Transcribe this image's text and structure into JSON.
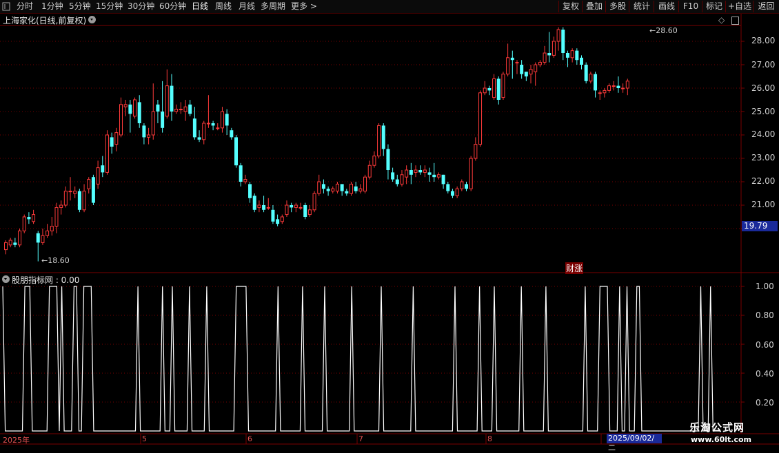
{
  "toolbar": {
    "tabs": [
      "分时",
      "1分钟",
      "5分钟",
      "15分钟",
      "30分钟",
      "60分钟",
      "日线",
      "周线",
      "月线",
      "多周期",
      "更多 >"
    ],
    "active_tab": "日线",
    "right_buttons": [
      "复权",
      "叠加",
      "多股",
      "统计",
      "画线",
      "F10",
      "+自选",
      "返回"
    ]
  },
  "main_title": "上海家化(日线,前复权)",
  "sub_title": "股朋指标网 : 0.00",
  "price_axis": [
    "28.00",
    "27.00",
    "26.00",
    "25.00",
    "24.00",
    "23.00",
    "22.00",
    "21.00"
  ],
  "indicator_axis": [
    "1.00",
    "0.80",
    "0.60",
    "0.40",
    "0.20"
  ],
  "date_labels": [
    "2025年",
    "5",
    "6",
    "7",
    "8"
  ],
  "current_price": "19.79",
  "high_marker": "28.60",
  "low_marker": "18.60",
  "event_label": "财涨",
  "crosshair_date": "2025/09/02/二",
  "watermark_title": "乐淘公式网",
  "watermark_url": "www.60lt.com",
  "colors": {
    "up": "#ff3a3a",
    "down": "#54ffff",
    "grid": "#7a0000",
    "line": "#ffffff",
    "highlight": "#1a2a9a"
  },
  "chart_data": [
    {
      "type": "candlestick",
      "title": "上海家化(日线,前复权)",
      "ylim": [
        19.0,
        28.9
      ],
      "up_color": "#ff3a3a",
      "down_color": "#54ffff",
      "candles": [
        [
          19.1,
          19.4,
          18.9,
          19.5
        ],
        [
          19.3,
          19.5,
          19.2,
          19.6
        ],
        [
          19.4,
          19.3,
          19.2,
          19.6
        ],
        [
          19.3,
          19.9,
          19.2,
          20.0
        ],
        [
          19.9,
          20.5,
          19.8,
          20.6
        ],
        [
          20.5,
          20.4,
          20.2,
          20.7
        ],
        [
          20.3,
          20.6,
          20.2,
          20.8
        ],
        [
          19.8,
          19.4,
          18.6,
          19.9
        ],
        [
          19.4,
          19.7,
          19.3,
          20.0
        ],
        [
          19.7,
          19.9,
          19.6,
          20.2
        ],
        [
          19.9,
          20.1,
          19.7,
          20.5
        ],
        [
          20.1,
          20.9,
          19.8,
          21.1
        ],
        [
          20.9,
          21.0,
          20.6,
          21.2
        ],
        [
          21.0,
          21.6,
          20.9,
          21.8
        ],
        [
          21.6,
          21.6,
          21.2,
          22.2
        ],
        [
          21.5,
          21.6,
          21.3,
          21.8
        ],
        [
          21.6,
          20.8,
          20.7,
          21.7
        ],
        [
          20.8,
          21.6,
          20.7,
          21.9
        ],
        [
          21.7,
          22.1,
          21.5,
          22.2
        ],
        [
          22.2,
          21.1,
          21.0,
          22.3
        ],
        [
          21.9,
          22.6,
          21.7,
          22.9
        ],
        [
          22.7,
          22.4,
          22.2,
          23.1
        ],
        [
          22.4,
          24.0,
          22.3,
          24.2
        ],
        [
          23.9,
          23.5,
          23.2,
          24.1
        ],
        [
          23.6,
          24.1,
          23.3,
          24.3
        ],
        [
          24.0,
          25.3,
          23.9,
          25.6
        ],
        [
          25.2,
          25.3,
          24.8,
          25.5
        ],
        [
          25.3,
          24.9,
          24.1,
          25.5
        ],
        [
          24.8,
          25.5,
          24.7,
          25.6
        ],
        [
          25.4,
          24.5,
          24.3,
          25.7
        ],
        [
          24.4,
          23.9,
          23.6,
          24.5
        ],
        [
          23.9,
          24.0,
          23.6,
          24.3
        ],
        [
          24.0,
          25.0,
          23.8,
          26.2
        ],
        [
          25.3,
          25.0,
          24.5,
          25.5
        ],
        [
          25.0,
          24.3,
          24.1,
          26.3
        ],
        [
          24.8,
          26.1,
          24.7,
          26.8
        ],
        [
          26.1,
          25.0,
          24.6,
          26.6
        ],
        [
          25.0,
          25.1,
          24.9,
          25.3
        ],
        [
          25.1,
          25.1,
          24.9,
          25.4
        ],
        [
          25.0,
          25.2,
          24.6,
          25.5
        ],
        [
          25.3,
          24.9,
          24.8,
          25.5
        ],
        [
          24.7,
          23.9,
          23.8,
          25.2
        ],
        [
          23.9,
          23.8,
          23.7,
          24.2
        ],
        [
          23.8,
          24.5,
          23.6,
          24.6
        ],
        [
          24.5,
          24.5,
          24.3,
          25.7
        ],
        [
          24.5,
          24.4,
          24.2,
          24.6
        ],
        [
          24.3,
          24.3,
          24.2,
          24.5
        ],
        [
          24.3,
          25.0,
          24.1,
          25.2
        ],
        [
          24.9,
          24.4,
          24.0,
          25.1
        ],
        [
          24.2,
          23.9,
          23.8,
          24.3
        ],
        [
          23.9,
          22.7,
          22.6,
          24.0
        ],
        [
          22.7,
          22.0,
          21.8,
          22.8
        ],
        [
          22.0,
          22.1,
          21.9,
          22.3
        ],
        [
          21.9,
          21.3,
          21.1,
          22.0
        ],
        [
          21.4,
          20.8,
          20.7,
          21.5
        ],
        [
          20.9,
          21.0,
          20.7,
          21.2
        ],
        [
          21.0,
          20.8,
          20.7,
          21.4
        ],
        [
          20.9,
          20.9,
          20.8,
          21.3
        ],
        [
          20.8,
          20.3,
          20.2,
          21.0
        ],
        [
          20.4,
          20.2,
          20.1,
          20.6
        ],
        [
          20.3,
          20.5,
          20.2,
          20.6
        ],
        [
          20.6,
          21.0,
          20.5,
          21.2
        ],
        [
          21.0,
          20.9,
          20.7,
          21.1
        ],
        [
          20.9,
          21.0,
          20.7,
          21.1
        ],
        [
          20.9,
          20.9,
          20.8,
          21.1
        ],
        [
          21.0,
          20.5,
          20.4,
          21.1
        ],
        [
          20.6,
          20.8,
          20.5,
          21.0
        ],
        [
          20.8,
          21.5,
          20.7,
          21.6
        ],
        [
          21.5,
          22.0,
          21.4,
          22.3
        ],
        [
          21.9,
          21.7,
          21.5,
          22.1
        ],
        [
          21.7,
          21.6,
          21.4,
          21.8
        ],
        [
          21.6,
          21.7,
          21.5,
          21.8
        ],
        [
          21.6,
          21.9,
          21.5,
          22.0
        ],
        [
          21.9,
          21.6,
          21.4,
          21.9
        ],
        [
          21.6,
          21.5,
          21.4,
          21.7
        ],
        [
          21.5,
          21.9,
          21.4,
          22.0
        ],
        [
          21.8,
          21.6,
          21.5,
          22.0
        ],
        [
          21.6,
          21.7,
          21.5,
          21.9
        ],
        [
          21.6,
          22.2,
          21.5,
          22.3
        ],
        [
          22.2,
          22.7,
          22.1,
          22.9
        ],
        [
          22.7,
          23.1,
          22.6,
          23.3
        ],
        [
          23.1,
          24.4,
          23.0,
          24.5
        ],
        [
          24.4,
          23.4,
          23.1,
          24.5
        ],
        [
          23.4,
          22.5,
          22.1,
          23.6
        ],
        [
          22.4,
          22.1,
          22.0,
          22.6
        ],
        [
          22.1,
          21.9,
          21.8,
          22.3
        ],
        [
          21.9,
          22.3,
          21.8,
          22.5
        ],
        [
          22.2,
          22.5,
          21.9,
          22.7
        ],
        [
          22.5,
          22.3,
          21.9,
          22.8
        ],
        [
          22.4,
          22.5,
          22.2,
          22.7
        ],
        [
          22.5,
          22.4,
          22.3,
          22.7
        ],
        [
          22.4,
          22.5,
          22.2,
          22.7
        ],
        [
          22.4,
          22.3,
          22.0,
          22.6
        ],
        [
          22.3,
          22.2,
          22.0,
          22.8
        ],
        [
          22.2,
          22.3,
          22.1,
          22.4
        ],
        [
          22.3,
          21.9,
          21.7,
          22.3
        ],
        [
          21.9,
          21.6,
          21.5,
          22.0
        ],
        [
          21.6,
          21.4,
          21.3,
          21.7
        ],
        [
          21.4,
          21.7,
          21.3,
          21.8
        ],
        [
          21.7,
          22.0,
          21.6,
          22.1
        ],
        [
          21.9,
          21.7,
          21.6,
          22.0
        ],
        [
          21.7,
          23.0,
          21.6,
          23.1
        ],
        [
          23.0,
          23.6,
          22.9,
          23.9
        ],
        [
          23.6,
          25.8,
          23.5,
          25.9
        ],
        [
          25.8,
          26.0,
          25.7,
          26.3
        ],
        [
          26.0,
          25.9,
          25.7,
          26.1
        ],
        [
          25.6,
          26.4,
          25.5,
          26.6
        ],
        [
          26.4,
          25.5,
          25.3,
          26.5
        ],
        [
          25.6,
          26.6,
          25.5,
          26.7
        ],
        [
          26.6,
          27.3,
          26.5,
          27.9
        ],
        [
          27.3,
          27.2,
          26.4,
          27.6
        ],
        [
          27.1,
          27.1,
          26.6,
          27.2
        ],
        [
          27.0,
          26.6,
          26.4,
          27.2
        ],
        [
          26.7,
          26.5,
          26.3,
          26.7
        ],
        [
          26.6,
          26.8,
          26.2,
          27.0
        ],
        [
          26.7,
          27.0,
          26.1,
          27.1
        ],
        [
          27.0,
          27.1,
          26.9,
          27.2
        ],
        [
          27.1,
          27.5,
          27.0,
          27.8
        ],
        [
          27.5,
          27.4,
          27.1,
          28.4
        ],
        [
          27.4,
          28.0,
          27.3,
          28.2
        ],
        [
          28.0,
          28.5,
          27.6,
          28.6
        ],
        [
          28.5,
          27.5,
          27.2,
          28.6
        ],
        [
          27.5,
          27.3,
          26.9,
          27.6
        ],
        [
          27.3,
          27.6,
          27.1,
          27.7
        ],
        [
          27.6,
          27.2,
          27.0,
          27.7
        ],
        [
          27.3,
          27.0,
          26.8,
          27.4
        ],
        [
          27.0,
          26.3,
          26.2,
          27.1
        ],
        [
          26.3,
          26.6,
          26.2,
          26.7
        ],
        [
          26.6,
          25.9,
          25.6,
          26.7
        ],
        [
          25.8,
          25.8,
          25.5,
          25.9
        ],
        [
          25.8,
          25.9,
          25.6,
          26.0
        ],
        [
          25.9,
          26.1,
          25.8,
          26.2
        ],
        [
          26.1,
          26.1,
          25.9,
          26.3
        ],
        [
          26.1,
          26.0,
          25.8,
          26.5
        ],
        [
          26.0,
          26.0,
          25.8,
          26.2
        ],
        [
          26.0,
          26.3,
          25.7,
          26.4
        ]
      ]
    },
    {
      "type": "line",
      "title": "股朋指标网",
      "ylim": [
        0.0,
        1.05
      ],
      "series": [
        {
          "values": [
            1,
            0,
            0,
            0,
            0,
            0,
            0,
            0,
            0,
            1,
            1,
            1,
            0,
            0,
            0,
            0,
            0,
            0,
            0,
            1,
            1,
            1,
            1,
            0,
            1,
            0,
            0,
            0,
            0,
            1,
            1,
            0,
            0,
            1,
            1,
            1,
            1,
            0,
            0,
            0,
            0,
            0,
            0,
            0,
            0,
            0,
            0,
            0,
            0,
            0,
            0,
            0,
            0,
            0,
            0,
            1,
            0,
            0,
            0,
            0,
            0,
            0,
            0,
            0,
            0,
            1,
            0,
            0,
            0,
            1,
            0,
            0,
            0,
            0,
            0,
            0,
            1,
            0,
            0,
            0,
            0,
            0,
            0,
            1,
            0,
            0,
            0,
            0,
            0,
            0,
            0,
            0,
            0,
            0,
            0,
            1,
            1,
            1,
            1,
            1,
            0,
            0,
            0,
            0,
            0,
            0,
            0,
            0,
            0,
            0,
            0,
            0,
            1,
            0,
            0,
            0,
            0,
            0,
            0,
            0,
            0,
            0,
            1,
            0,
            0,
            0,
            0,
            0,
            0,
            0,
            0,
            1,
            0,
            0,
            0,
            0,
            0,
            0,
            0,
            0,
            0,
            0,
            1,
            0,
            0,
            0,
            0,
            0,
            0,
            0,
            0,
            0,
            0,
            0,
            1,
            0,
            0,
            0,
            0,
            0,
            0,
            0,
            0,
            0,
            0,
            0,
            0,
            1,
            0,
            0,
            0,
            0,
            0,
            0,
            0,
            0,
            0,
            0,
            0,
            0,
            0,
            0,
            0,
            0,
            1,
            0,
            0,
            0,
            0,
            0,
            0,
            0,
            0,
            0,
            1,
            0,
            0,
            0,
            0,
            0,
            1,
            0,
            0,
            0,
            0,
            0,
            0,
            0,
            0,
            0,
            0,
            1,
            0,
            0,
            0,
            0,
            0,
            0,
            0,
            0,
            0,
            1,
            0,
            0,
            0,
            0,
            0,
            0,
            0,
            0,
            0,
            0,
            0,
            0,
            0,
            0,
            0,
            1,
            0,
            0,
            0,
            0,
            0,
            1,
            1,
            1,
            1,
            0,
            0,
            0,
            0,
            1,
            0,
            0,
            1,
            0,
            0,
            0,
            1,
            1,
            0,
            0,
            0,
            0,
            0,
            0,
            0,
            0,
            0,
            0,
            0,
            0,
            0,
            0,
            0,
            0,
            0,
            0,
            0,
            0,
            0,
            0,
            0,
            0,
            1,
            0,
            0,
            0,
            1,
            0,
            0,
            0,
            0
          ]
        }
      ]
    }
  ]
}
